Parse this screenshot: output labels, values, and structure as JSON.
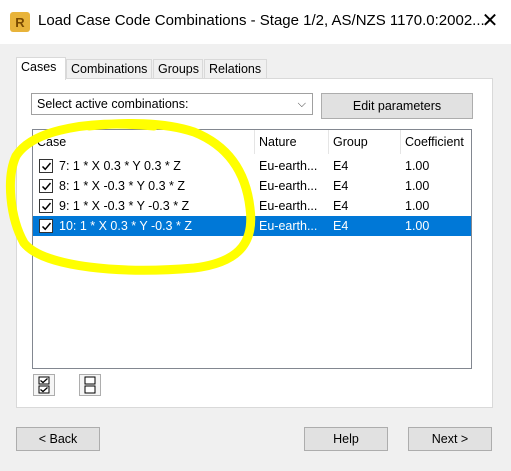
{
  "window": {
    "title": "Load Case Code Combinations - Stage 1/2, AS/NZS 1170.0:2002...",
    "icon_letter": "R",
    "close_glyph": "✕"
  },
  "tabs": [
    {
      "label": "Cases"
    },
    {
      "label": "Combinations"
    },
    {
      "label": "Groups"
    },
    {
      "label": "Relations"
    }
  ],
  "selector": {
    "value": "Select active combinations:",
    "chevron": "⌵"
  },
  "edit_button": "Edit parameters",
  "table": {
    "columns": [
      "Case",
      "Nature",
      "Group",
      "Coefficient"
    ],
    "rows": [
      {
        "case": "7: 1 * X  0.3 * Y  0.3 * Z",
        "nature": "Eu-earth...",
        "group": "E4",
        "coefficient": "1.00",
        "checked": true
      },
      {
        "case": "8: 1 * X  -0.3 * Y  0.3 * Z",
        "nature": "Eu-earth...",
        "group": "E4",
        "coefficient": "1.00",
        "checked": true
      },
      {
        "case": "9: 1 * X  -0.3 * Y  -0.3 * Z",
        "nature": "Eu-earth...",
        "group": "E4",
        "coefficient": "1.00",
        "checked": true
      },
      {
        "case": "10: 1 * X  0.3 * Y  -0.3 * Z",
        "nature": "Eu-earth...",
        "group": "E4",
        "coefficient": "1.00",
        "checked": true,
        "selected": true
      }
    ]
  },
  "icons": {
    "check_all": "check-all-icon",
    "uncheck_all": "uncheck-all-icon"
  },
  "footer": {
    "back": "< Back",
    "help": "Help",
    "next": "Next >"
  },
  "colors": {
    "selection": "#0078d7",
    "highlight_marker": "#ffff00"
  }
}
